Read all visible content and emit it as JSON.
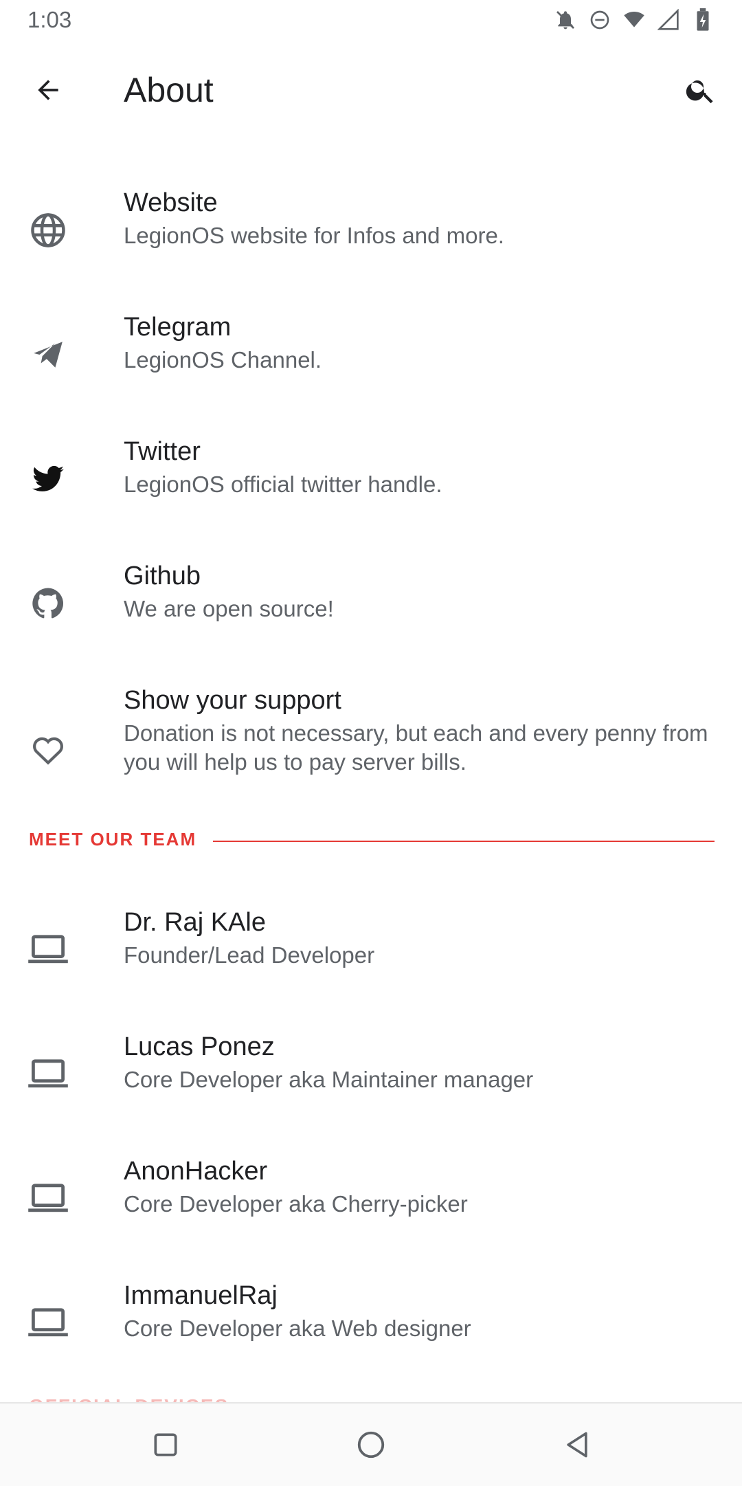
{
  "status": {
    "time": "1:03",
    "icons": [
      "notifications-off-icon",
      "do-not-disturb-icon",
      "wifi-icon",
      "signal-icon",
      "battery-charging-icon"
    ]
  },
  "appbar": {
    "title": "About",
    "back_icon": "arrow-back-icon",
    "search_icon": "search-icon"
  },
  "links": [
    {
      "title": "Website",
      "subtitle": "LegionOS website for Infos and more.",
      "icon": "globe-icon"
    },
    {
      "title": "Telegram",
      "subtitle": "LegionOS Channel.",
      "icon": "telegram-icon"
    },
    {
      "title": "Twitter",
      "subtitle": "LegionOS official twitter handle.",
      "icon": "twitter-icon"
    },
    {
      "title": "Github",
      "subtitle": "We are open source!",
      "icon": "github-icon"
    },
    {
      "title": "Show your support",
      "subtitle": "Donation is not necessary, but each and every penny from you will help us to pay server bills.",
      "icon": "heart-icon"
    }
  ],
  "team_section": {
    "label": "MEET OUR TEAM",
    "accent": "#e53935"
  },
  "team": [
    {
      "title": "Dr. Raj KAle",
      "subtitle": "Founder/Lead Developer",
      "icon": "laptop-icon"
    },
    {
      "title": "Lucas Ponez",
      "subtitle": "Core Developer aka Maintainer manager",
      "icon": "laptop-icon"
    },
    {
      "title": "AnonHacker",
      "subtitle": "Core Developer aka Cherry-picker",
      "icon": "laptop-icon"
    },
    {
      "title": "ImmanuelRaj",
      "subtitle": "Core Developer aka Web designer",
      "icon": "laptop-icon"
    }
  ],
  "next_section": {
    "label": "OFFICIAL DEVICES"
  },
  "navbar": {
    "icons": [
      "recents-icon",
      "home-icon",
      "back-icon"
    ]
  }
}
